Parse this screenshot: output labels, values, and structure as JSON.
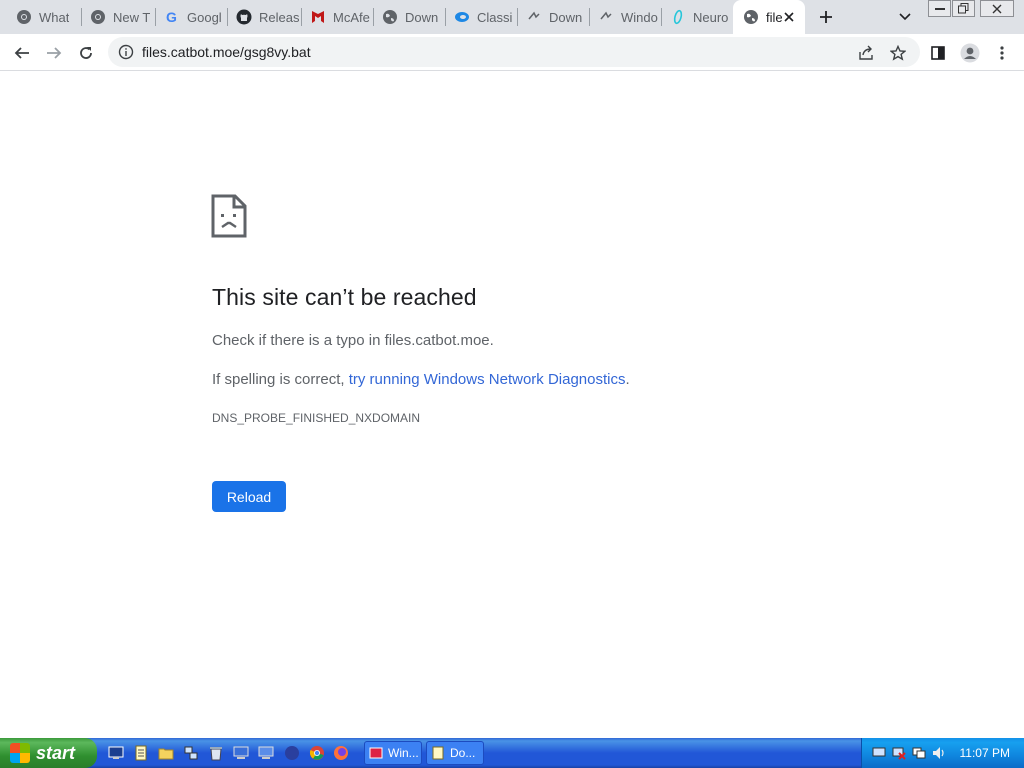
{
  "tabs": [
    {
      "title": "What",
      "icon": "chrome-icon"
    },
    {
      "title": "New T",
      "icon": "chrome-icon"
    },
    {
      "title": "Googl",
      "icon": "google-icon"
    },
    {
      "title": "Releas",
      "icon": "github-icon"
    },
    {
      "title": "McAfe",
      "icon": "mcafee-icon"
    },
    {
      "title": "Down",
      "icon": "globe-icon"
    },
    {
      "title": "Classi",
      "icon": "classic-icon"
    },
    {
      "title": "Down",
      "icon": "download-icon"
    },
    {
      "title": "Windo",
      "icon": "download-icon"
    },
    {
      "title": "Neuro",
      "icon": "neuro-icon"
    },
    {
      "title": "file",
      "icon": "globe-icon",
      "active": true
    }
  ],
  "omnibox": {
    "url": "files.catbot.moe/gsg8vy.bat"
  },
  "error": {
    "title": "This site can’t be reached",
    "line1": "Check if there is a typo in files.catbot.moe.",
    "line2_prefix": "If spelling is correct, ",
    "line2_link": "try running Windows Network Diagnostics",
    "line2_suffix": ".",
    "code": "DNS_PROBE_FINISHED_NXDOMAIN",
    "reload_label": "Reload"
  },
  "taskbar": {
    "start_label": "start",
    "tasks": [
      {
        "label": "Win..."
      },
      {
        "label": "Do..."
      }
    ],
    "clock": "11:07 PM"
  },
  "colors": {
    "accent": "#1a73e8",
    "tabstrip": "#dee1e6",
    "taskbar": "#2157d7",
    "start": "#3c9a3c"
  }
}
